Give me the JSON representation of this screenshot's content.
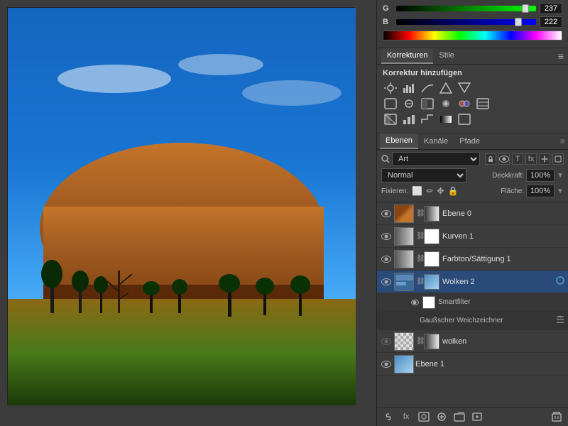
{
  "color_section": {
    "g_label": "G",
    "g_value": "237",
    "b_label": "B",
    "b_value": "222"
  },
  "korrekturen": {
    "tab1": "Korrekturen",
    "tab2": "Stile",
    "title": "Korrektur hinzufügen",
    "icons_row1": [
      "☀",
      "📊",
      "✏",
      "◇",
      "▽"
    ],
    "icons_row2": [
      "⊞",
      "⚖",
      "▣",
      "📷",
      "⊙",
      "⊞"
    ],
    "icons_row3": [
      "⬡",
      "◈",
      "◈",
      "▥",
      "⬜"
    ]
  },
  "ebenen": {
    "tabs": [
      "Ebenen",
      "Kanäle",
      "Pfade"
    ],
    "blend_mode": "Normal",
    "opacity_label": "Deckkraft:",
    "opacity_value": "100%",
    "flache_label": "Fläche:",
    "flache_value": "100%",
    "fixieren_label": "Fixieren:",
    "art_label": "Art",
    "layers": [
      {
        "name": "Ebene 0",
        "visible": true,
        "has_mask": true,
        "has_link": true,
        "thumb_class": "thumb-red",
        "mask_class": "thumb-dark-light",
        "active": false
      },
      {
        "name": "Kurven 1",
        "visible": true,
        "has_mask": true,
        "has_link": true,
        "thumb_class": "thumb-gray-white",
        "mask_class": "thumb-white",
        "active": false
      },
      {
        "name": "Farbton/Sättigung 1",
        "visible": true,
        "has_mask": true,
        "has_link": true,
        "thumb_class": "thumb-gray-white",
        "mask_class": "thumb-white",
        "active": false
      },
      {
        "name": "Wolken 2",
        "visible": true,
        "has_mask": true,
        "has_link": true,
        "thumb_class": "thumb-blue",
        "mask_class": "thumb-blue",
        "active": true,
        "has_right_icon": true
      },
      {
        "name": "Smartfilter",
        "visible": true,
        "is_smartfilter": true,
        "thumb_class": "thumb-white",
        "mask_class": ""
      },
      {
        "name": "Gaußscher Weichzeichner",
        "visible": false,
        "is_filter": true,
        "thumb_class": "",
        "mask_class": ""
      },
      {
        "name": "wolken",
        "visible": false,
        "has_mask": true,
        "has_link": true,
        "thumb_class": "thumb-checker",
        "mask_class": "thumb-dark-light",
        "active": false
      },
      {
        "name": "Ebene 1",
        "visible": true,
        "has_mask": false,
        "has_link": false,
        "thumb_class": "thumb-blue",
        "mask_class": "",
        "active": false
      }
    ]
  },
  "bottom_toolbar": {
    "icons": [
      "🔗",
      "fx",
      "⬜",
      "⊙",
      "📁",
      "🗑"
    ]
  }
}
